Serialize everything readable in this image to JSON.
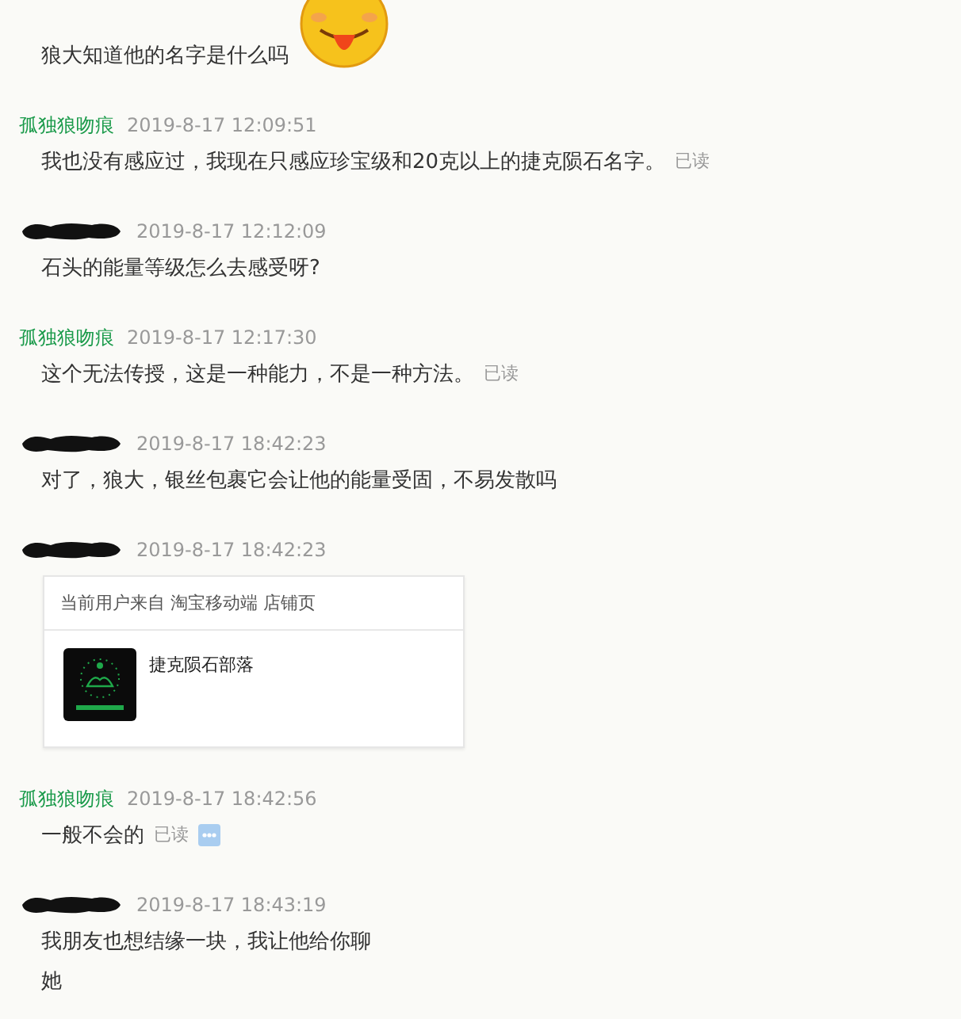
{
  "messages": [
    {
      "lines": [
        "狼大知道他的名字是什么吗"
      ],
      "emoji": true
    },
    {
      "sender": {
        "kind": "self",
        "name": "孤独狼吻痕"
      },
      "time": "2019-8-17 12:09:51",
      "lines": [
        "我也没有感应过，我现在只感应珍宝级和20克以上的捷克陨石名字。"
      ],
      "receipt": "已读"
    },
    {
      "sender": {
        "kind": "hidden"
      },
      "time": "2019-8-17 12:12:09",
      "lines": [
        "石头的能量等级怎么去感受呀?"
      ]
    },
    {
      "sender": {
        "kind": "self",
        "name": "孤独狼吻痕"
      },
      "time": "2019-8-17 12:17:30",
      "lines": [
        "这个无法传授，这是一种能力，不是一种方法。"
      ],
      "receipt": "已读"
    },
    {
      "sender": {
        "kind": "hidden"
      },
      "time": "2019-8-17 18:42:23",
      "lines": [
        "对了，狼大，银丝包裹它会让他的能量受固，不易发散吗"
      ]
    },
    {
      "sender": {
        "kind": "hidden"
      },
      "time": "2019-8-17 18:42:23",
      "card": {
        "header": "当前用户来自 淘宝移动端 店铺页",
        "title": "捷克陨石部落"
      }
    },
    {
      "sender": {
        "kind": "self",
        "name": "孤独狼吻痕"
      },
      "time": "2019-8-17 18:42:56",
      "lines": [
        "一般不会的"
      ],
      "receipt": "已读",
      "more": true
    },
    {
      "sender": {
        "kind": "hidden"
      },
      "time": "2019-8-17 18:43:19",
      "lines": [
        "我朋友也想结缘一块，我让他给你聊",
        "她"
      ]
    }
  ]
}
